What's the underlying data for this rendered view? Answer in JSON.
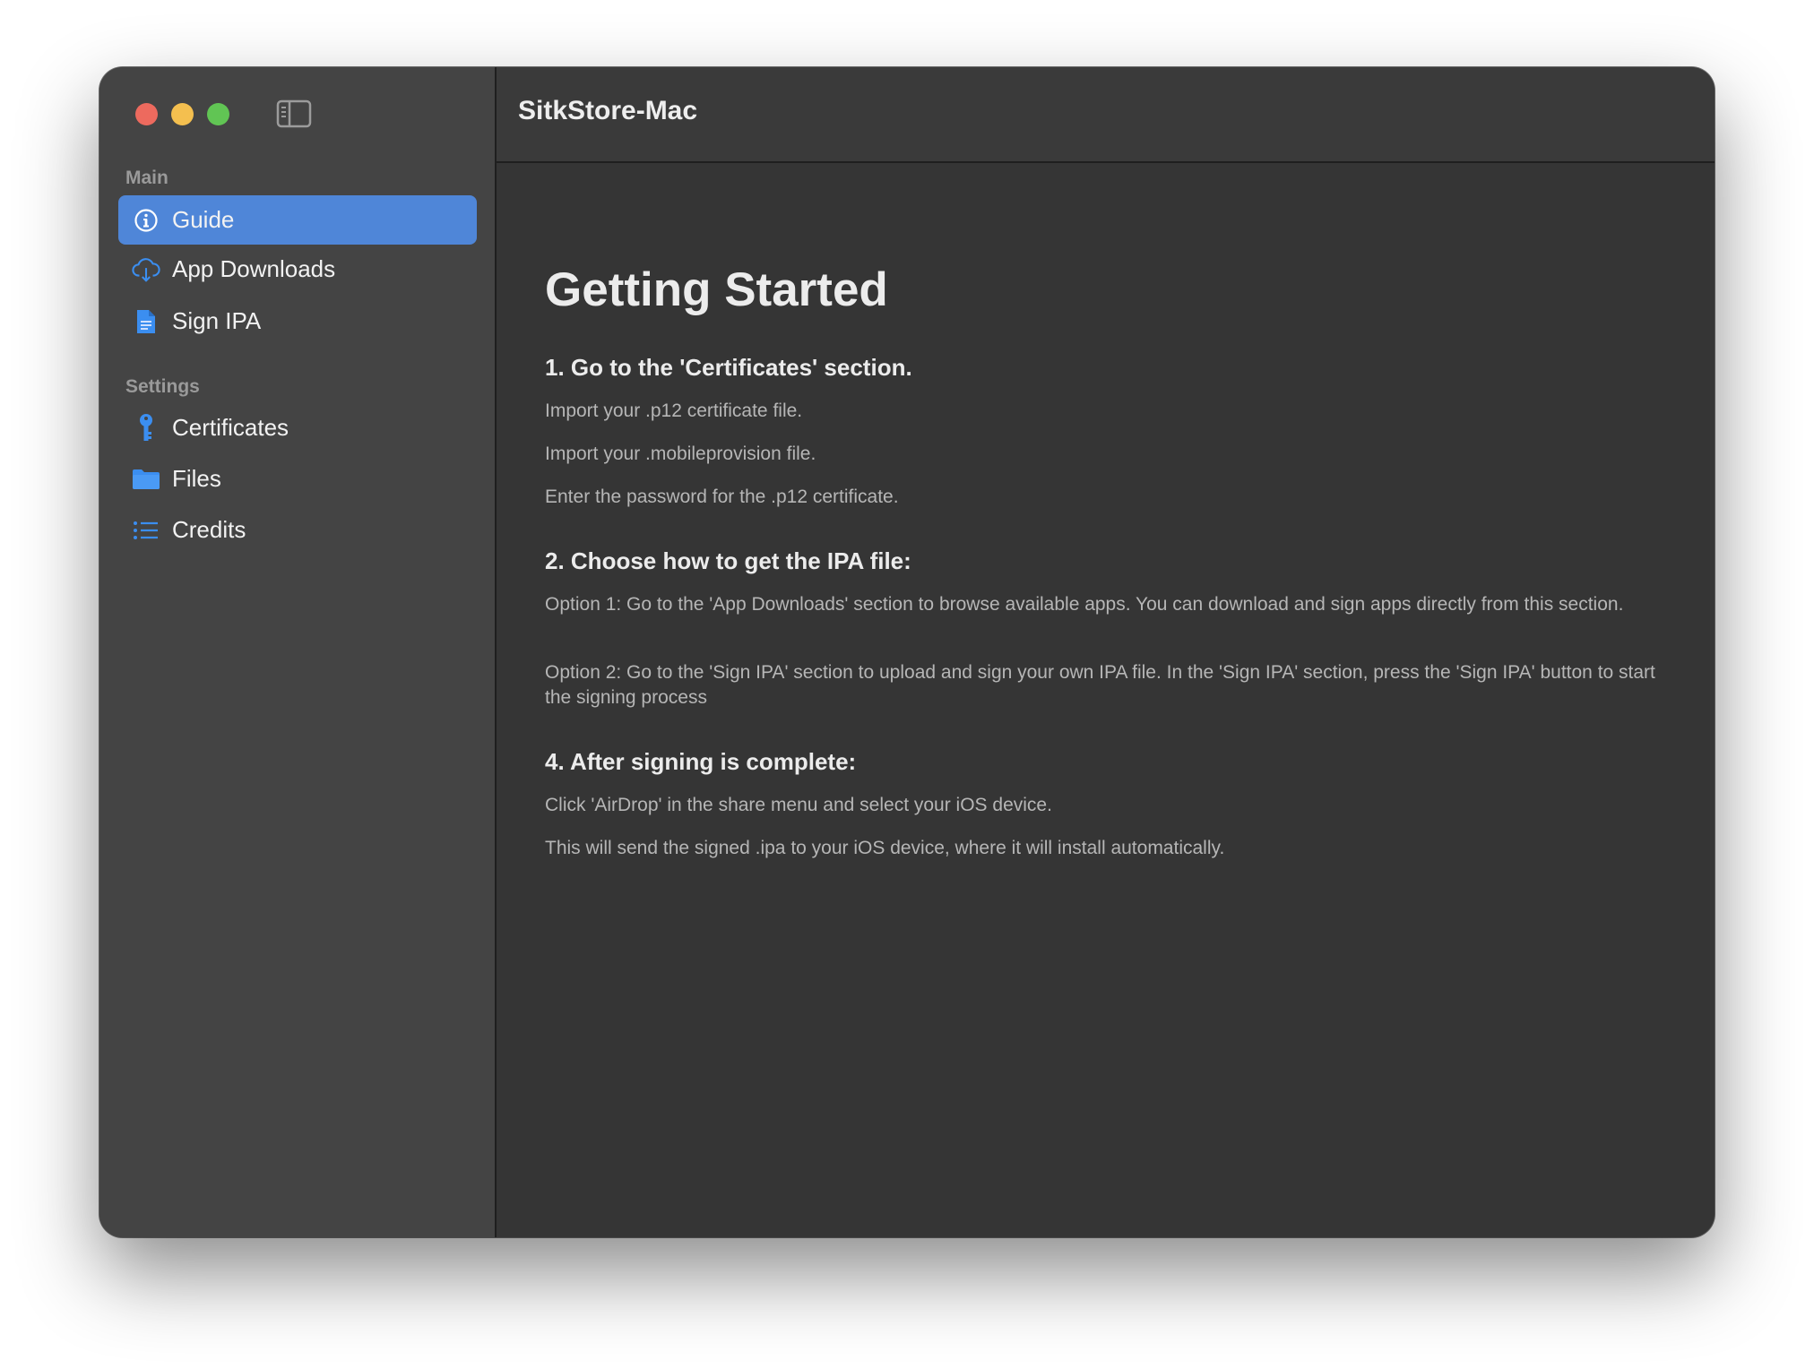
{
  "window": {
    "title": "SitkStore-Mac"
  },
  "sidebar": {
    "toggle_icon": "sidebar-left-icon",
    "sections": [
      {
        "label": "Main",
        "items": [
          {
            "label": "Guide",
            "icon": "info-circle-icon",
            "active": true
          },
          {
            "label": "App Downloads",
            "icon": "cloud-download-icon",
            "active": false
          },
          {
            "label": "Sign IPA",
            "icon": "document-icon",
            "active": false
          }
        ]
      },
      {
        "label": "Settings",
        "items": [
          {
            "label": "Certificates",
            "icon": "key-icon",
            "active": false
          },
          {
            "label": "Files",
            "icon": "folder-icon",
            "active": false
          },
          {
            "label": "Credits",
            "icon": "list-icon",
            "active": false
          }
        ]
      }
    ]
  },
  "colors": {
    "accent": "#4f86d8",
    "icon_blue": "#3b8ef0",
    "sidebar_bg": "#444444",
    "content_bg": "#353535"
  },
  "guide": {
    "title": "Getting Started",
    "steps": [
      {
        "heading": "1. Go to the 'Certificates' section.",
        "lines": [
          "Import your .p12 certificate file.",
          "Import your .mobileprovision file.",
          "Enter the password for the .p12 certificate."
        ]
      },
      {
        "heading": "2. Choose how to get the IPA file:",
        "lines": [
          "Option 1: Go to the 'App Downloads' section to browse available apps. You can download and sign apps directly from this section.",
          "Option 2: Go to the 'Sign IPA' section to upload and sign your own IPA file. In the 'Sign IPA' section, press the 'Sign IPA' button to start the signing process"
        ]
      },
      {
        "heading": "4. After signing is complete:",
        "lines": [
          "Click 'AirDrop' in the share menu and select your iOS device.",
          "This will send the signed .ipa to your iOS device, where it will install automatically."
        ]
      }
    ]
  }
}
